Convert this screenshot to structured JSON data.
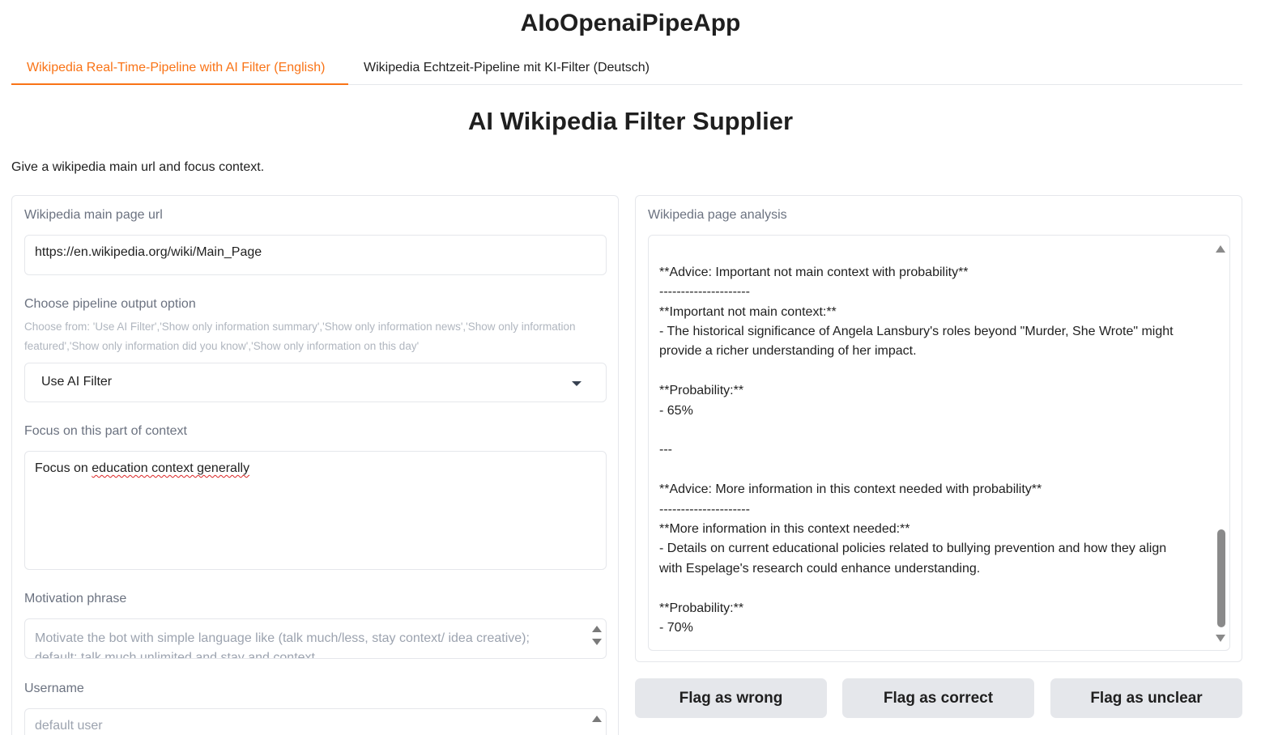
{
  "app": {
    "title": "AIoOpenaiPipeApp"
  },
  "tabs": [
    {
      "label": "Wikipedia Real-Time-Pipeline with AI Filter (English)"
    },
    {
      "label": "Wikipedia Echtzeit-Pipeline mit KI-Filter (Deutsch)"
    }
  ],
  "page": {
    "heading": "AI Wikipedia Filter Supplier",
    "description": "Give a wikipedia main url and focus context."
  },
  "form": {
    "url": {
      "label": "Wikipedia main page url",
      "value": "https://en.wikipedia.org/wiki/Main_Page"
    },
    "pipeline": {
      "label": "Choose pipeline output option",
      "hint": "Choose from: 'Use AI Filter','Show only information summary','Show only information news','Show only information featured','Show only information did you know','Show only information on this day'",
      "selected": "Use AI Filter"
    },
    "focus": {
      "label": "Focus on this part of context",
      "value_prefix": "Focus on ",
      "value_misspelled": "education context generally"
    },
    "motivation": {
      "label": "Motivation phrase",
      "placeholder_line1": "Motivate the bot with simple language like (talk much/less, stay context/ idea creative);",
      "placeholder_line2": "default: talk much unlimited and stay and context"
    },
    "username": {
      "label": "Username",
      "placeholder": "default user"
    }
  },
  "output": {
    "label": "Wikipedia page analysis",
    "lines": [
      "---",
      "",
      "**Advice: Important not main context with probability**",
      "---------------------",
      "**Important not main context:**",
      "- The historical significance of Angela Lansbury's roles beyond \"Murder, She Wrote\" might",
      "provide a richer understanding of her impact.",
      "",
      "**Probability:**",
      "- 65%",
      "",
      "---",
      "",
      "**Advice: More information in this context needed with probability**",
      "---------------------",
      "**More information in this context needed:**",
      "- Details on current educational policies related to bullying prevention and how they align",
      "with Espelage's research could enhance understanding.",
      "",
      "**Probability:**",
      "- 70%"
    ]
  },
  "flags": {
    "wrong": "Flag as wrong",
    "correct": "Flag as correct",
    "unclear": "Flag as unclear"
  },
  "colors": {
    "accent": "#f97316",
    "button_bg": "#e5e7eb",
    "border": "#e5e7eb"
  }
}
